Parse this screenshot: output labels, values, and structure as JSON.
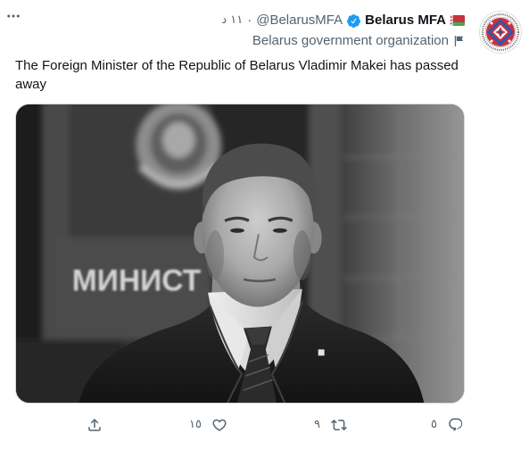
{
  "tweet": {
    "more_icon": "more-icon",
    "author": {
      "display_name": "Belarus MFA",
      "handle": "@BelarusMFA",
      "verified": true,
      "flag_icon": "belarus-flag-icon",
      "avatar_icon": "ministry-seal-avatar"
    },
    "separator": "·",
    "timestamp": "١١ د",
    "affiliation": {
      "label": "Belarus government organization",
      "icon": "government-flag-icon"
    },
    "text": "The Foreign Minister of the Republic of Belarus Vladimir Makei has passed away",
    "media": {
      "wall_lettering": "МИНИСТ"
    },
    "actions": {
      "reply": {
        "icon": "reply-icon",
        "count": "٥"
      },
      "retweet": {
        "icon": "retweet-icon",
        "count": "٩"
      },
      "like": {
        "icon": "heart-icon",
        "count": "١٥"
      },
      "share": {
        "icon": "share-icon"
      }
    }
  },
  "colors": {
    "text": "#0f1419",
    "secondary": "#536471",
    "accent": "#1d9bf0",
    "border": "#cfd9de",
    "background": "#ffffff",
    "flag_red": "#c8313e",
    "flag_green": "#4aa657"
  }
}
